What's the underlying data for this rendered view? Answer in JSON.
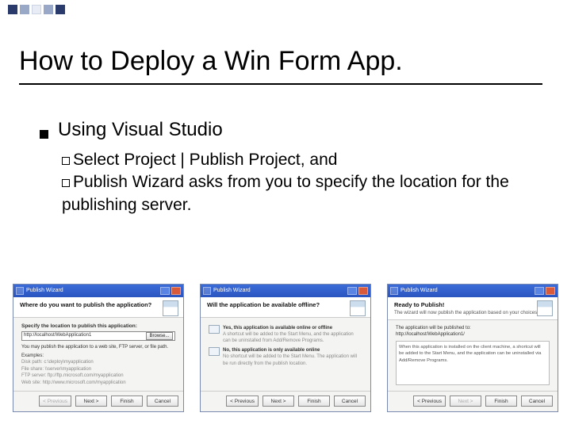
{
  "header": {
    "title": "How to Deploy a Win Form App."
  },
  "bullets": {
    "main": "Using Visual Studio",
    "sub1": "Select Project | Publish Project, and",
    "sub2": "Publish Wizard asks from you to specify the location for the publishing server."
  },
  "wizard": {
    "titlebar": "Publish Wizard",
    "buttons": {
      "previous": "< Previous",
      "next": "Next >",
      "finish": "Finish",
      "cancel": "Cancel",
      "browse": "Browse..."
    },
    "step1": {
      "question": "Where do you want to publish the application?",
      "sub": "Specify the location to publish this application:",
      "input": "http://localhost/WebApplication1",
      "hint_label": "You may publish the application to a web site, FTP server, or file path.",
      "ex_label": "Examples:",
      "ex_disk": "Disk path:      c:\\deploy\\myapplication",
      "ex_share": "File share:     \\\\server\\myapplication",
      "ex_ftp": "FTP server:    ftp://ftp.microsoft.com/myapplication",
      "ex_web": "Web site:       http://www.microsoft.com/myapplication"
    },
    "step2": {
      "question": "Will the application be available offline?",
      "opt1_title": "Yes, this application is available online or offline",
      "opt1_desc": "A shortcut will be added to the Start Menu, and the application can be uninstalled from Add/Remove Programs.",
      "opt2_title": "No, this application is only available online",
      "opt2_desc": "No shortcut will be added to the Start Menu. The application will be run directly from the publish location."
    },
    "step3": {
      "question": "Ready to Publish!",
      "sub": "The wizard will now publish the application based on your choices.",
      "box_l1": "The application will be published to:",
      "box_l2": "http://localhost/WebApplication1/",
      "box_l3": "When this application is installed on the client machine, a shortcut will be added to the Start Menu, and the application can be uninstalled via Add/Remove Programs."
    }
  }
}
